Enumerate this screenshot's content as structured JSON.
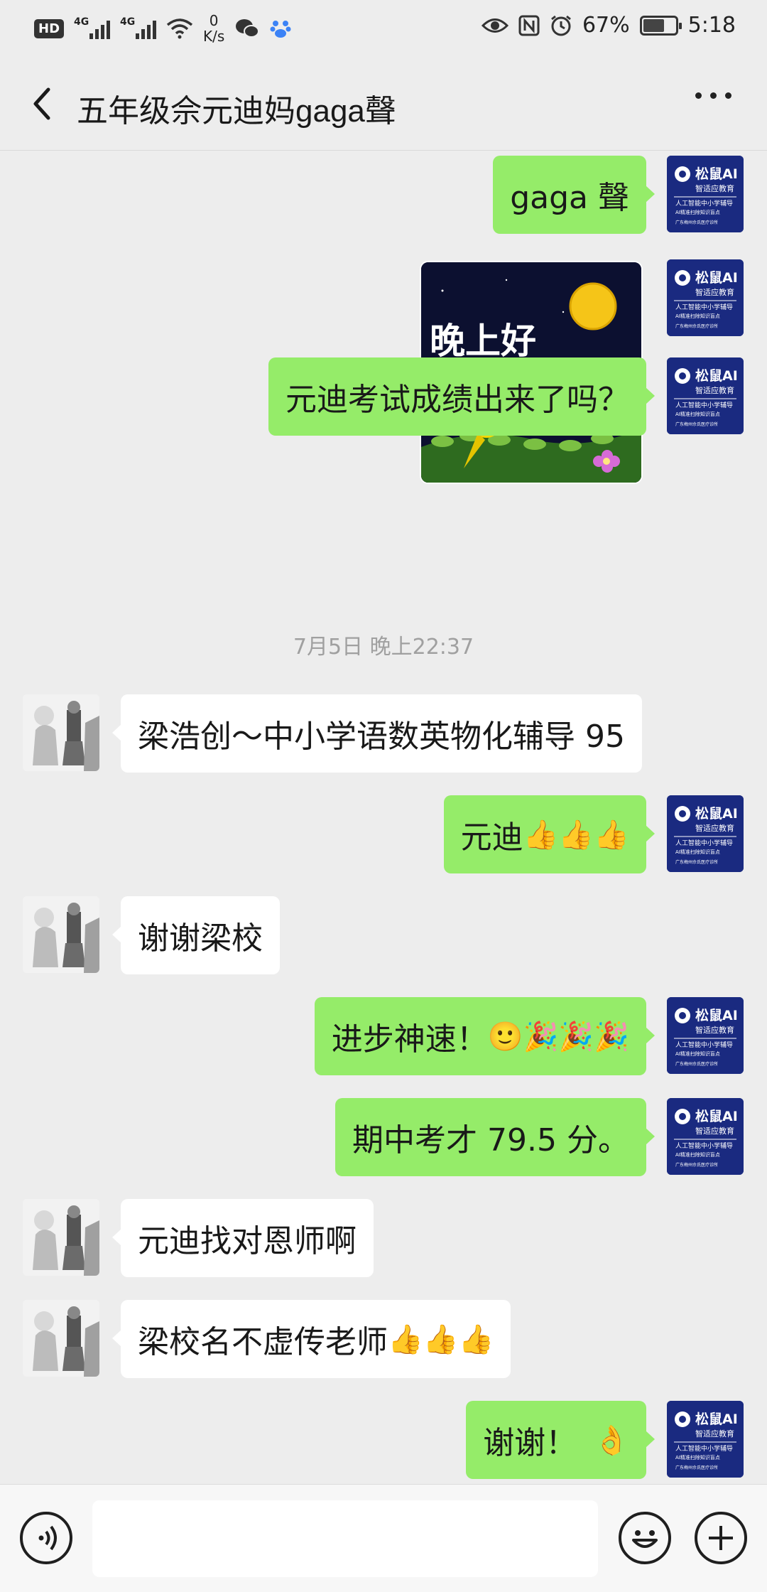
{
  "status_bar": {
    "hd": "HD",
    "net1": "4G",
    "net2": "4G",
    "speed_value": "0",
    "speed_unit": "K/s",
    "battery": "67%",
    "time": "5:18"
  },
  "header": {
    "title": "五年级佘元迪妈gaga聲"
  },
  "sticker": {
    "text": "晚上好"
  },
  "messages": {
    "m1": "gaga 聲",
    "m2": "元迪考试成绩出来了吗？",
    "timestamp": "7月5日 晚上22:37",
    "m3": "梁浩创～中小学语数英物化辅导  95",
    "m4": "元迪",
    "m4_emoji": "👍👍👍",
    "m5": "谢谢梁校",
    "m6": "进步神速！",
    "m6_emoji": "🙂🎉🎉🎉",
    "m7": "期中考才 79.5 分。",
    "m8": "元迪找对恩师啊",
    "m9": "梁校名不虚传老师",
    "m9_emoji": "👍👍👍",
    "m10": "谢谢！",
    "m10_emoji": "👌"
  },
  "my_avatar": {
    "brand": "松鼠AI",
    "sub": "智适应教育",
    "line1": "人工智能中小学辅导",
    "line2": "AI精准扫除知识盲点",
    "line3": "广东梅州佘氏医疗诊所"
  },
  "colors": {
    "outgoing_bubble": "#95ec69",
    "incoming_bubble": "#ffffff",
    "background": "#ededed",
    "my_avatar_bg": "#1a2a80"
  },
  "icons": {
    "back": "chevron-left-icon",
    "more": "more-dots-icon",
    "voice": "voice-icon",
    "emoji": "emoji-icon",
    "plus": "plus-icon"
  }
}
